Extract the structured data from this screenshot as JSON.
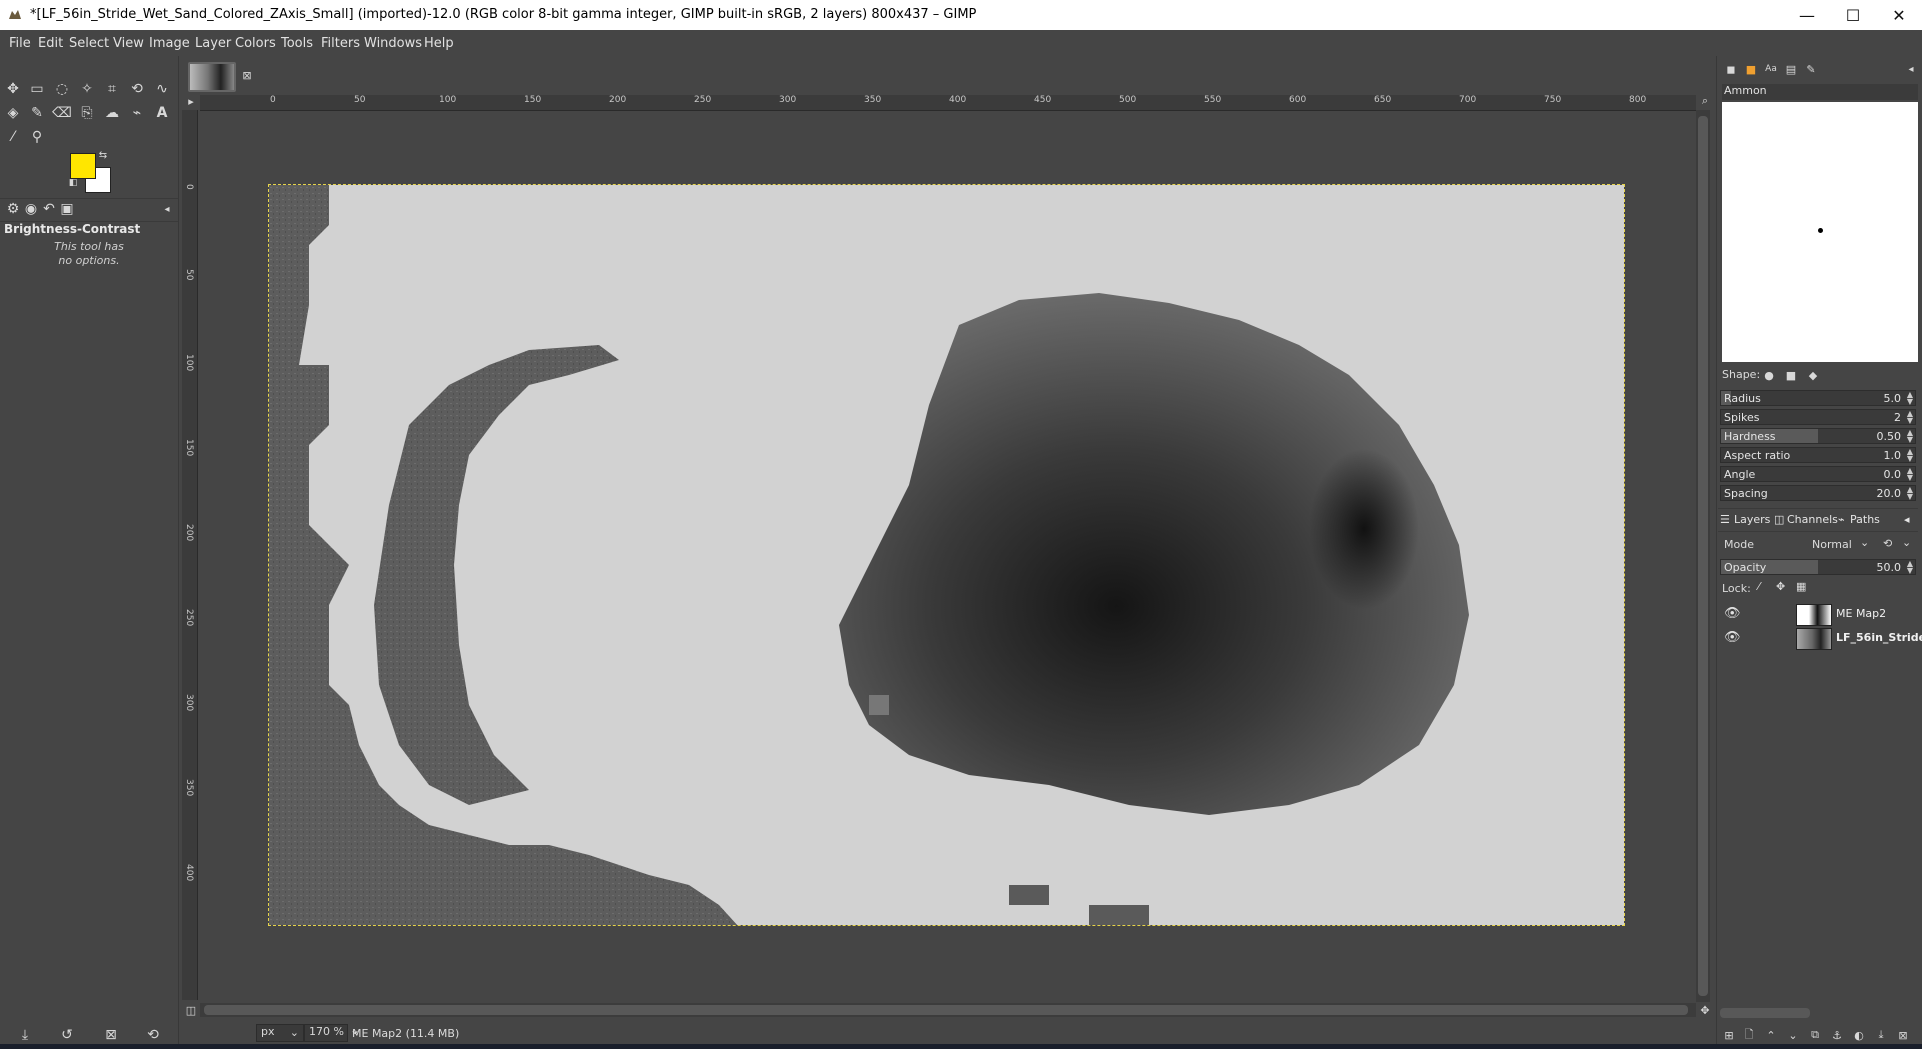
{
  "window": {
    "title": "*[LF_56in_Stride_Wet_Sand_Colored_ZAxis_Small] (imported)-12.0 (RGB color 8-bit gamma integer, GIMP built-in sRGB, 2 layers) 800x437 – GIMP",
    "minimize": "—",
    "maximize": "☐",
    "close": "✕"
  },
  "menu": [
    "File",
    "Edit",
    "Select",
    "View",
    "Image",
    "Layer",
    "Colors",
    "Tools",
    "Filters",
    "Windows",
    "Help"
  ],
  "colors": {
    "foreground": "#ffe600",
    "background": "#ffffff",
    "accent_selection": "#e6d44a"
  },
  "tool_options": {
    "title": "Brightness-Contrast",
    "note_line1": "This tool has",
    "note_line2": "no options."
  },
  "ruler": {
    "h_ticks": [
      "0",
      "50",
      "100",
      "150",
      "200",
      "250",
      "300",
      "350",
      "400",
      "450",
      "500",
      "550",
      "600",
      "650",
      "700",
      "750",
      "800"
    ],
    "v_ticks": [
      "0",
      "50",
      "100",
      "150",
      "200",
      "250",
      "300",
      "350",
      "400"
    ]
  },
  "status": {
    "unit": "px",
    "zoom": "170 %",
    "message": "ME Map2 (11.4 MB)"
  },
  "brushes": {
    "name": "Ammon",
    "shape_label": "Shape:",
    "params": [
      {
        "label": "Radius",
        "value": "5.0",
        "fill": 0.05
      },
      {
        "label": "Spikes",
        "value": "2",
        "fill": 0.0
      },
      {
        "label": "Hardness",
        "value": "0.50",
        "fill": 0.5
      },
      {
        "label": "Aspect ratio",
        "value": "1.0",
        "fill": 0.0
      },
      {
        "label": "Angle",
        "value": "0.0",
        "fill": 0.0
      },
      {
        "label": "Spacing",
        "value": "20.0",
        "fill": 0.0
      }
    ]
  },
  "layers_panel": {
    "tabs": [
      "Layers",
      "Channels",
      "Paths"
    ],
    "mode_label": "Mode",
    "mode_value": "Normal",
    "opacity_label": "Opacity",
    "opacity_value": "50.0",
    "opacity_fraction": 0.5,
    "lock_label": "Lock:",
    "layers": [
      {
        "name": "ME Map2"
      },
      {
        "name": "LF_56in_Stride"
      }
    ]
  }
}
